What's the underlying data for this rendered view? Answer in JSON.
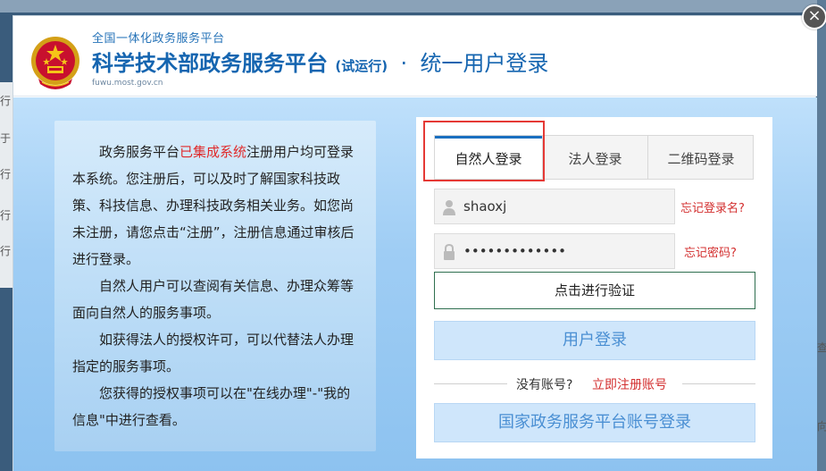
{
  "header": {
    "sub_title": "全国一体化政务服务平台",
    "main_title": "科学技术部政务服务平台",
    "trial_label": "(试运行)",
    "separator": "·",
    "unified_login": "统一用户登录",
    "domain": "fuwu.most.gov.cn"
  },
  "info_panel": {
    "p1_before": "政务服务平台",
    "p1_highlight": "已集成系统",
    "p1_after": "注册用户均可登录本系统。您注册后，可以及时了解国家科技政策、科技信息、办理科技政务相关业务。如您尚未注册，请您点击“注册”，注册信息通过审核后进行登录。",
    "p2": "自然人用户可以查阅有关信息、办理众筹等面向自然人的服务事项。",
    "p3": "如获得法人的授权许可，可以代替法人办理指定的服务事项。",
    "p4": "您获得的授权事项可以在\"在线办理\"-\"我的信息\"中进行查看。"
  },
  "tabs": [
    {
      "label": "自然人登录",
      "active": true
    },
    {
      "label": "法人登录",
      "active": false
    },
    {
      "label": "二维码登录",
      "active": false
    }
  ],
  "login": {
    "username_value": "shaoxj",
    "password_value": "•••••••••••••",
    "forgot_username": "忘记登录名?",
    "forgot_password": "忘记密码?",
    "verify_label": "点击进行验证",
    "login_label": "用户登录",
    "no_account": "没有账号?",
    "register_label": "立即注册账号",
    "national_login_label": "国家政务服务平台账号登录"
  },
  "close_symbol": "×",
  "backdrop": {
    "left_chars": [
      "行",
      "于",
      "行",
      "行",
      "行"
    ],
    "right_chars": [
      "查",
      "向"
    ]
  },
  "colors": {
    "brand_blue": "#1565b0",
    "accent_red": "#d32f2f",
    "highlight_box": "#e53935"
  }
}
